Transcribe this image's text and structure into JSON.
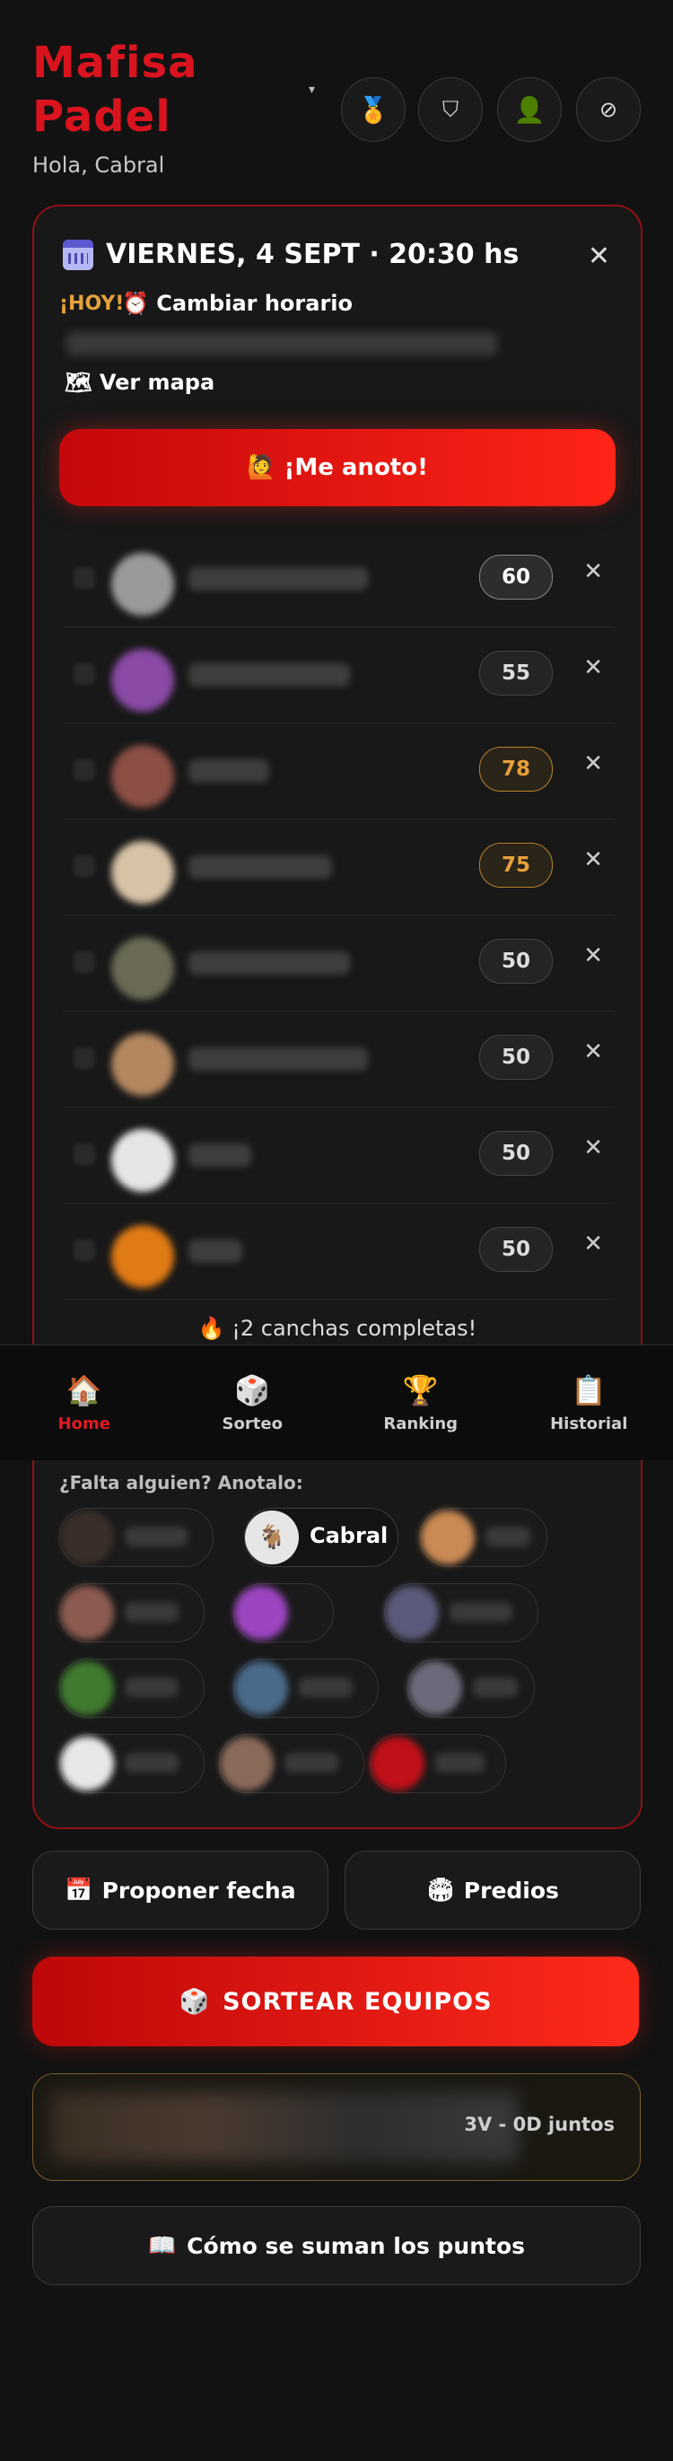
{
  "app": {
    "title_line1": "Mafisa",
    "title_line2": "Padel",
    "greeting": "Hola, Cabral",
    "dropdown_caret": "▾"
  },
  "header_buttons": [
    {
      "name": "medal-icon",
      "glyph": "🏅"
    },
    {
      "name": "shield-icon",
      "glyph": "⛉"
    },
    {
      "name": "user-icon",
      "glyph": "👤"
    },
    {
      "name": "block-icon",
      "glyph": "⊘"
    }
  ],
  "match": {
    "date_label": "VIERNES, 4 SEPT · 20:30 hs",
    "today_badge": "¡HOY!",
    "change_time_label": "⏰ Cambiar horario",
    "map_label": "🗺 Ver mapa",
    "join_label": "🙋 ¡Me anoto!",
    "close_glyph": "✕",
    "players": [
      {
        "points": "60",
        "style": "sel",
        "avatar_color": "#9a9a9a"
      },
      {
        "points": "55",
        "style": "",
        "avatar_color": "#8a4aa6"
      },
      {
        "points": "78",
        "style": "gold",
        "avatar_color": "#8b4f45"
      },
      {
        "points": "75",
        "style": "gold",
        "avatar_color": "#d7c2a6"
      },
      {
        "points": "50",
        "style": "",
        "avatar_color": "#6a6a55"
      },
      {
        "points": "50",
        "style": "",
        "avatar_color": "#b38760"
      },
      {
        "points": "50",
        "style": "",
        "avatar_color": "#e6e6e6"
      },
      {
        "points": "50",
        "style": "",
        "avatar_color": "#e07a14"
      }
    ],
    "remove_glyph": "✕",
    "courts_status": "🔥 ¡2 canchas completas!"
  },
  "nav": [
    {
      "label": "Home",
      "icon": "🏠",
      "active": true
    },
    {
      "label": "Sorteo",
      "icon": "🎲",
      "active": false
    },
    {
      "label": "Ranking",
      "icon": "🏆",
      "active": false
    },
    {
      "label": "Historial",
      "icon": "📋",
      "active": false
    }
  ],
  "missing": {
    "title": "¿Falta alguien? Anotalo:",
    "highlight_name": "Cabral",
    "highlight_icon": "🐐"
  },
  "actions": {
    "propose_date": "Proponer fecha",
    "propose_icon": "📅",
    "predios": "Predios",
    "predios_icon": "🏟",
    "draw_teams": "SORTEAR EQUIPOS",
    "draw_icon": "🎲",
    "duo_stat": "3V - 0D juntos",
    "how_points": "Cómo se suman los puntos",
    "how_icon": "📖"
  }
}
